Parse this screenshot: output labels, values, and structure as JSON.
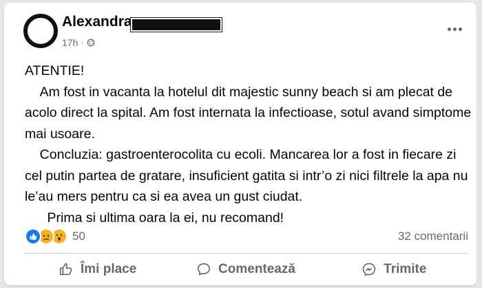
{
  "post": {
    "author": "Alexandra",
    "time": "17h",
    "separator": "·",
    "body": [
      "ATENTIE!",
      "    Am fost in vacanta la hotelul dit majestic sunny beach si am plecat de acolo direct la spital. Am fost internata la infectioase, sotul avand simptome mai usoare.",
      "    Concluzia: gastroenterocolita cu ecoli. Mancarea lor a fost in fiecare zi cel putin partea de gratare, insuficient gatita si intr’o zi nici filtrele la apa nu le’au mers pentru ca si ea avea un gust ciudat.",
      "      Prima si ultima oara la ei, nu recomand!"
    ],
    "reaction_count": "50",
    "comment_count": "32 comentarii",
    "reaction_icons": [
      "like-icon",
      "sad-icon",
      "wow-icon"
    ]
  },
  "actions": {
    "like_label": "Îmi place",
    "comment_label": "Comentează",
    "share_label": "Trimite"
  },
  "colors": {
    "accent": "#1877f2",
    "secondary_text": "#65676b",
    "card": "#ffffff",
    "background": "#e4e6eb"
  }
}
